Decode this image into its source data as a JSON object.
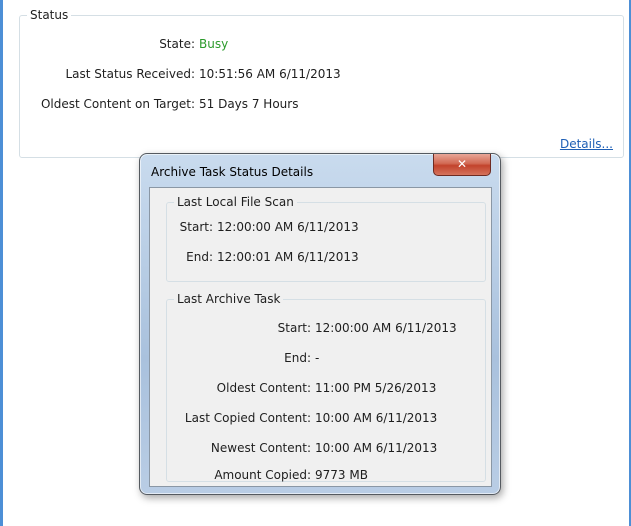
{
  "status": {
    "legend": "Status",
    "state_label": "State:",
    "state_value": "Busy",
    "received_label": "Last Status Received:",
    "received_value": "10:51:56 AM 6/11/2013",
    "oldest_label": "Oldest Content on Target:",
    "oldest_value": "51 Days 7 Hours",
    "details_link": "Details..."
  },
  "dialog": {
    "title": "Archive Task Status Details",
    "close_glyph": "✕",
    "local_scan": {
      "legend": "Last Local File Scan",
      "start_label": "Start:",
      "start_value": "12:00:00 AM 6/11/2013",
      "end_label": "End:",
      "end_value": "12:00:01 AM 6/11/2013"
    },
    "archive_task": {
      "legend": "Last Archive Task",
      "start_label": "Start:",
      "start_value": "12:00:00 AM 6/11/2013",
      "end_label": "End:",
      "end_value": "-",
      "oldest_label": "Oldest Content:",
      "oldest_value": "11:00 PM 5/26/2013",
      "last_copied_label": "Last Copied Content:",
      "last_copied_value": "10:00 AM 6/11/2013",
      "newest_label": "Newest Content:",
      "newest_value": "10:00 AM 6/11/2013",
      "amount_label": "Amount Copied:",
      "amount_value": "9773 MB"
    }
  },
  "colors": {
    "busy": "#2b9a2b",
    "link": "#1e5fb5",
    "window_border": "#4d8fd6",
    "close_button": "#c2432c"
  }
}
